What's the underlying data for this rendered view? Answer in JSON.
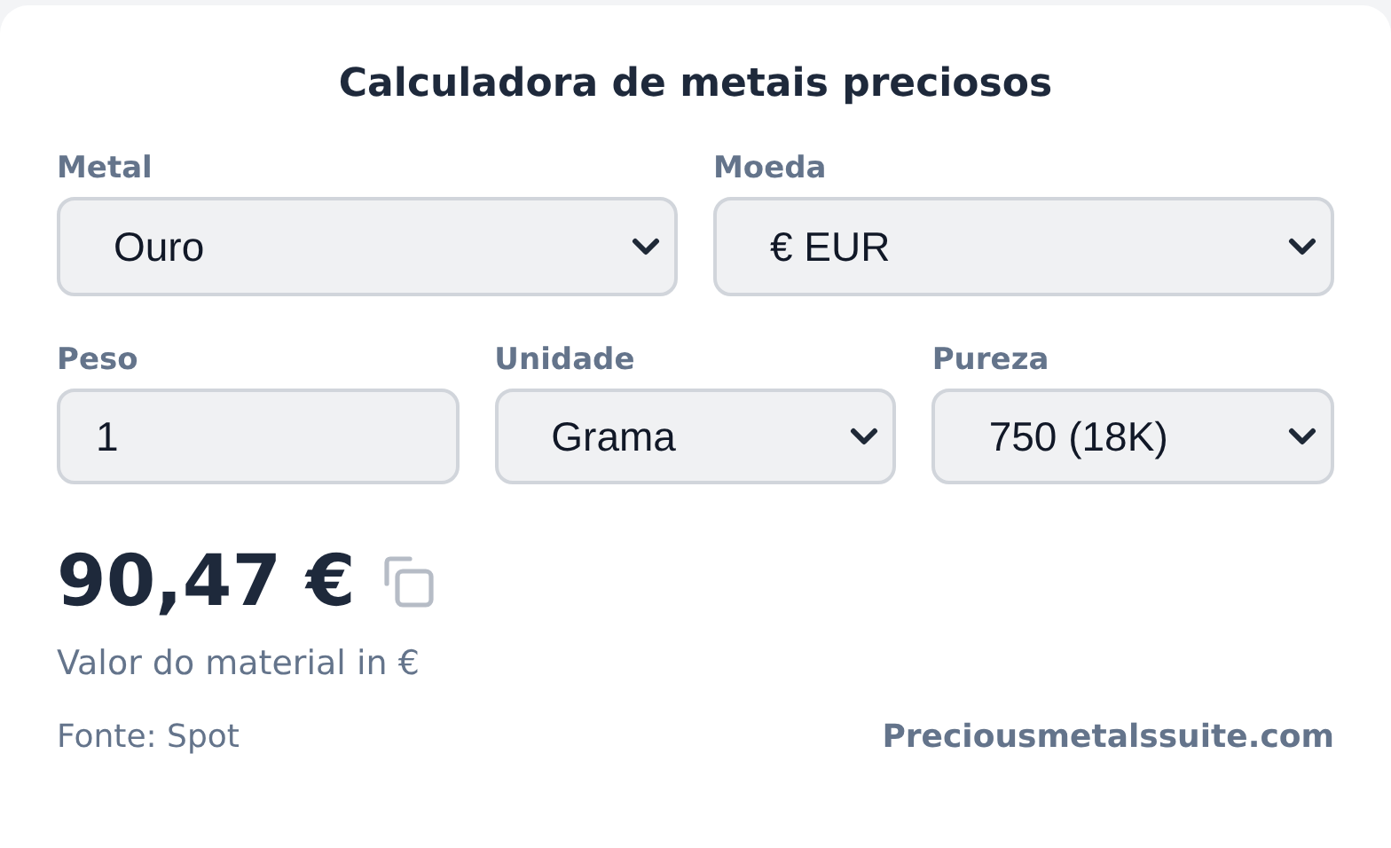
{
  "title": "Calculadora de metais preciosos",
  "rows": [
    [
      {
        "kind": "select",
        "label": "Metal",
        "value": "Ouro"
      },
      {
        "kind": "select",
        "label": "Moeda",
        "value": "€ EUR"
      }
    ],
    [
      {
        "kind": "input",
        "label": "Peso",
        "value": "1"
      },
      {
        "kind": "select",
        "label": "Unidade",
        "value": "Grama"
      },
      {
        "kind": "select",
        "label": "Pureza",
        "value": "750 (18K)"
      }
    ]
  ],
  "result": {
    "value": "90,47 €",
    "caption": "Valor do material in €"
  },
  "footer": {
    "source": "Fonte: Spot",
    "link": "Preciousmetalssuite.com"
  }
}
